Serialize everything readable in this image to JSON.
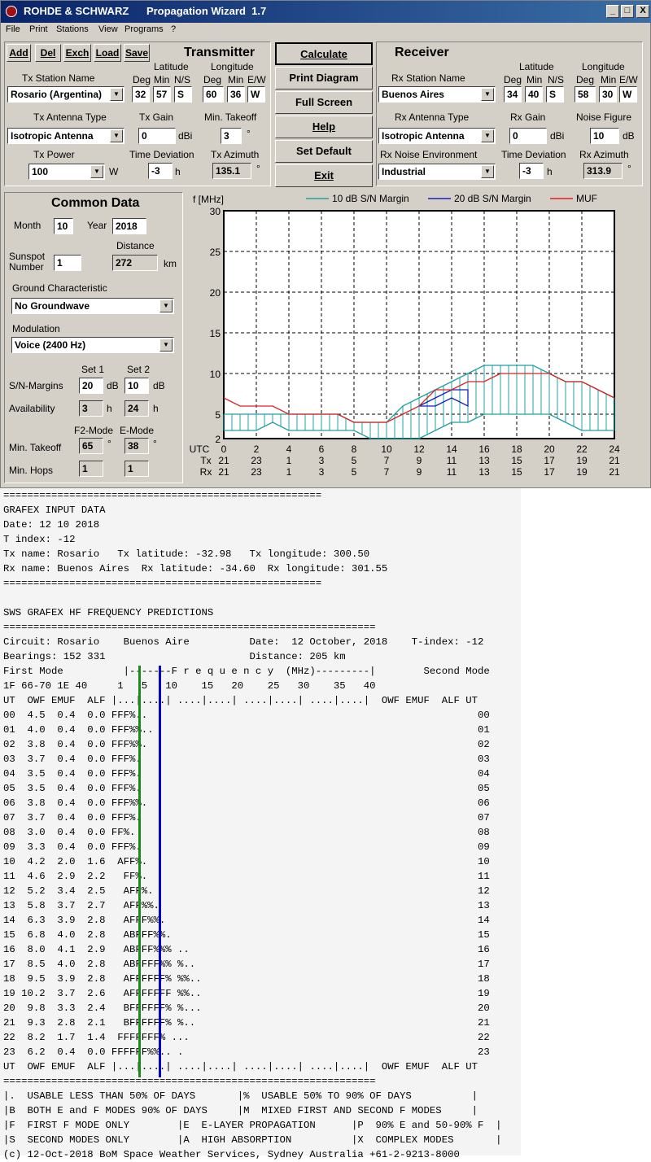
{
  "window": {
    "title": "ROHDE & SCHWARZ      Propagation Wizard  1.7",
    "btn_min": "_",
    "btn_max": "□",
    "btn_close": "X"
  },
  "menu": [
    "File",
    "Print",
    "Stations",
    "View",
    "Programs",
    "?"
  ],
  "toolbar": {
    "add": "Add",
    "del": "Del",
    "exch": "Exch",
    "load": "Load",
    "save": "Save"
  },
  "transmitter": {
    "heading": "Transmitter",
    "lat_label": "Latitude",
    "lon_label": "Longitude",
    "deg": "Deg",
    "min": "Min",
    "ns": "N/S",
    "ew": "E/W",
    "station_label": "Tx Station Name",
    "station": "Rosario (Argentina)",
    "lat_deg": "32",
    "lat_min": "57",
    "lat_ns": "S",
    "lon_deg": "60",
    "lon_min": "36",
    "lon_ew": "W",
    "antenna_label": "Tx Antenna Type",
    "antenna": "Isotropic Antenna",
    "gain_label": "Tx Gain",
    "gain": "0",
    "gain_unit": "dBi",
    "takeoff_label": "Min. Takeoff",
    "takeoff": "3",
    "takeoff_unit": "°",
    "power_label": "Tx Power",
    "power": "100",
    "power_unit": "W",
    "timedev_label": "Time Deviation",
    "timedev": "-3",
    "timedev_unit": "h",
    "azimuth_label": "Tx Azimuth",
    "azimuth": "135.1",
    "azimuth_unit": "°"
  },
  "actions": {
    "calculate": "Calculate",
    "print_diagram": "Print Diagram",
    "full_screen": "Full Screen",
    "help": "Help",
    "set_default": "Set Default",
    "exit": "Exit"
  },
  "receiver": {
    "heading": "Receiver",
    "lat_label": "Latitude",
    "lon_label": "Longitude",
    "deg": "Deg",
    "min": "Min",
    "ns": "N/S",
    "ew": "E/W",
    "station_label": "Rx Station Name",
    "station": "Buenos Aires",
    "lat_deg": "34",
    "lat_min": "40",
    "lat_ns": "S",
    "lon_deg": "58",
    "lon_min": "30",
    "lon_ew": "W",
    "antenna_label": "Rx Antenna Type",
    "antenna": "Isotropic Antenna",
    "gain_label": "Rx Gain",
    "gain": "0",
    "gain_unit": "dBi",
    "noise_label": "Noise Figure",
    "noise": "10",
    "noise_unit": "dB",
    "env_label": "Rx Noise Environment",
    "env": "Industrial",
    "timedev_label": "Time Deviation",
    "timedev": "-3",
    "timedev_unit": "h",
    "azimuth_label": "Rx Azimuth",
    "azimuth": "313.9",
    "azimuth_unit": "°"
  },
  "common": {
    "heading": "Common Data",
    "month_label": "Month",
    "month": "10",
    "year_label": "Year",
    "year": "2018",
    "sunspot_label1": "Sunspot",
    "sunspot_label2": "Number",
    "sunspot": "1",
    "distance_label": "Distance",
    "distance": "272",
    "distance_unit": "km",
    "ground_label": "Ground Characteristic",
    "ground": "No Groundwave",
    "mod_label": "Modulation",
    "mod": "Voice   (2400 Hz)",
    "set1": "Set 1",
    "set2": "Set 2",
    "sn_label": "S/N-Margins",
    "sn1": "20",
    "sn2": "10",
    "sn_unit": "dB",
    "avail_label": "Availability",
    "avail1": "3",
    "avail2": "24",
    "avail_unit": "h",
    "f2_label": "F2-Mode",
    "e_label": "E-Mode",
    "takeoff_label": "Min. Takeoff",
    "f2_takeoff": "65",
    "e_takeoff": "38",
    "deg_unit": "°",
    "hops_label": "Min. Hops",
    "f2_hops": "1",
    "e_hops": "1"
  },
  "chart_data": {
    "type": "area",
    "ylabel": "f [MHz]",
    "ylim": [
      2,
      30
    ],
    "xlim": [
      0,
      24
    ],
    "yticks": [
      "30",
      "25",
      "20",
      "15",
      "10",
      "5",
      "2"
    ],
    "xrow_labels": {
      "utc": "UTC",
      "tx": "Tx",
      "rx": "Rx"
    },
    "x_utc": [
      "0",
      "2",
      "4",
      "6",
      "8",
      "10",
      "12",
      "14",
      "16",
      "18",
      "20",
      "22",
      "24"
    ],
    "x_tx": [
      "21",
      "23",
      "1",
      "3",
      "5",
      "7",
      "9",
      "11",
      "13",
      "15",
      "17",
      "19",
      "21"
    ],
    "x_rx": [
      "21",
      "23",
      "1",
      "3",
      "5",
      "7",
      "9",
      "11",
      "13",
      "15",
      "17",
      "19",
      "21"
    ],
    "legend": [
      {
        "name": "10 dB S/N Margin",
        "color": "#20a0a0"
      },
      {
        "name": "20 dB S/N Margin",
        "color": "#1020c0"
      },
      {
        "name": "MUF",
        "color": "#e02020"
      }
    ],
    "hours": [
      0,
      1,
      2,
      3,
      4,
      5,
      6,
      7,
      8,
      9,
      10,
      11,
      12,
      13,
      14,
      15,
      16,
      17,
      18,
      19,
      20,
      21,
      22,
      23,
      24
    ],
    "muf": [
      7,
      6,
      6,
      6,
      5,
      5,
      5,
      5,
      4,
      4,
      4,
      5,
      6,
      8,
      8,
      9,
      9,
      10,
      10,
      10,
      10,
      9,
      9,
      8,
      7
    ],
    "band10_low": [
      3,
      3,
      3,
      4,
      3,
      3,
      3,
      3,
      3,
      2,
      2,
      2,
      2,
      3,
      4,
      4,
      5,
      5,
      5,
      5,
      5,
      4,
      3,
      3,
      3
    ],
    "band10_high": [
      5,
      5,
      5,
      5,
      5,
      5,
      5,
      5,
      4,
      4,
      4,
      6,
      7,
      8,
      9,
      10,
      11,
      11,
      11,
      11,
      10,
      9,
      9,
      8,
      7
    ],
    "band20_x": [
      12,
      13,
      14,
      15,
      15,
      14,
      13,
      12
    ],
    "band20_y": [
      6,
      6,
      7,
      6,
      8,
      8,
      7,
      6
    ]
  },
  "report": {
    "lines": [
      "=====================================================",
      "GRAFEX INPUT DATA",
      "Date: 12 10 2018",
      "T index: -12",
      "Tx name: Rosario   Tx latitude: -32.98   Tx longitude: 300.50",
      "Rx name: Buenos Aires  Rx latitude: -34.60  Rx longitude: 301.55",
      "=====================================================",
      "",
      "SWS GRAFEX HF FREQUENCY PREDICTIONS",
      "==============================================================",
      "Circuit: Rosario    Buenos Aire          Date:  12 October, 2018    T-index: -12",
      "Bearings: 152 331                        Distance: 205 km",
      "First Mode          |-------F r e q u e n c y  (MHz)---------|        Second Mode",
      "1F 66-70 1E 40     1   5   10    15   20    25   30    35   40",
      "UT  OWF EMUF  ALF |...|....| ....|....| ....|....| ....|....|  OWF EMUF  ALF UT",
      "00  4.5  0.4  0.0 FFF%..                                                       00",
      "01  4.0  0.4  0.0 FFF%%..                                                      01",
      "02  3.8  0.4  0.0 FFF%%.                                                       02",
      "03  3.7  0.4  0.0 FFF%.                                                        03",
      "04  3.5  0.4  0.0 FFF%.                                                        04",
      "05  3.5  0.4  0.0 FFF%.                                                        05",
      "06  3.8  0.4  0.0 FFF%%.                                                       06",
      "07  3.7  0.4  0.0 FFF%.                                                        07",
      "08  3.0  0.4  0.0 FF%.                                                         08",
      "09  3.3  0.4  0.0 FFF%.                                                        09",
      "10  4.2  2.0  1.6  AFF%.                                                       10",
      "11  4.6  2.9  2.2   FF%.                                                       11",
      "12  5.2  3.4  2.5   AFF%.                                                      12",
      "13  5.8  3.7  2.7   AFF%%.                                                     13",
      "14  6.3  3.9  2.8   AFFF%%.                                                    14",
      "15  6.8  4.0  2.8   ABFFF%%.                                                   15",
      "16  8.0  4.1  2.9   ABFFF%%% ..                                                16",
      "17  8.5  4.0  2.8   ABFFFF%% %..                                               17",
      "18  9.5  3.9  2.8   AFFFFFF% %%..                                              18",
      "19 10.2  3.7  2.6   AFFFFFFF %%..                                              19",
      "20  9.8  3.3  2.4   BFFFFFF% %...                                              20",
      "21  9.3  2.8  2.1   BFFFFFF% %..                                               21",
      "22  8.2  1.7  1.4  FFFFFFF% ...                                                22",
      "23  6.2  0.4  0.0 FFFFFF%%.. .                                                 23",
      "UT  OWF EMUF  ALF |...|....| ....|....| ....|....| ....|....|  OWF EMUF  ALF UT",
      "==============================================================",
      "|.  USABLE LESS THAN 50% OF DAYS       |%  USABLE 50% TO 90% OF DAYS          |",
      "|B  BOTH E and F MODES 90% OF DAYS     |M  MIXED FIRST AND SECOND F MODES     |",
      "|F  FIRST F MODE ONLY        |E  E-LAYER PROPAGATION      |P  90% E and 50-90% F  |",
      "|S  SECOND MODES ONLY        |A  HIGH ABSORPTION          |X  COMPLEX MODES       |",
      "(c) 12-Oct-2018 BoM Space Weather Services, Sydney Australia +61-2-9213-8000"
    ]
  }
}
